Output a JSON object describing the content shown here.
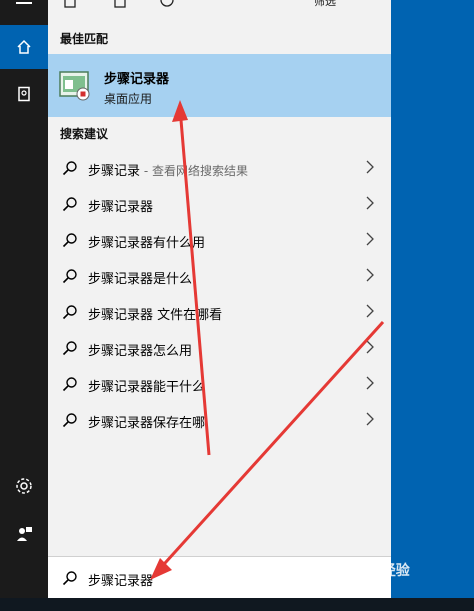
{
  "best_match": {
    "header": "最佳匹配",
    "title": "步骤记录器",
    "subtitle": "桌面应用"
  },
  "suggestions": {
    "header": "搜索建议",
    "items": [
      {
        "label": "步骤记录",
        "sub": " - 查看网络搜索结果"
      },
      {
        "label": "步骤记录器",
        "sub": ""
      },
      {
        "label": "步骤记录器有什么用",
        "sub": ""
      },
      {
        "label": "步骤记录器是什么",
        "sub": ""
      },
      {
        "label": "步骤记录器 文件在哪看",
        "sub": ""
      },
      {
        "label": "步骤记录器怎么用",
        "sub": ""
      },
      {
        "label": "步骤记录器能干什么",
        "sub": ""
      },
      {
        "label": "步骤记录器保存在哪",
        "sub": ""
      }
    ]
  },
  "search": {
    "query": "步骤记录器"
  },
  "topbar": {
    "filter_label": "筛选"
  },
  "watermark": "Bai 经验",
  "colors": {
    "accent": "#0063b1",
    "highlight": "#a6d1f1",
    "arrow": "#e53935"
  }
}
